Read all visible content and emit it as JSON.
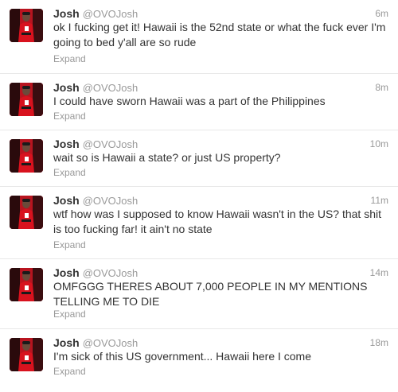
{
  "colors": {
    "avatar_bg": "#b8141f",
    "text": "#333333",
    "muted": "#999999",
    "divider": "#e8e8e8"
  },
  "tweets": [
    {
      "name": "Josh",
      "handle": "@OVOJosh",
      "time": "6m",
      "text": "ok I fucking get it! Hawaii is the 52nd state or what the fuck ever I'm going to bed y'all are so rude",
      "expand": "Expand",
      "avatar_icon": "profile-photo-icon"
    },
    {
      "name": "Josh",
      "handle": "@OVOJosh",
      "time": "8m",
      "text": "I could have sworn Hawaii was a part of the Philippines",
      "expand": "Expand",
      "avatar_icon": "profile-photo-icon"
    },
    {
      "name": "Josh",
      "handle": "@OVOJosh",
      "time": "10m",
      "text": "wait so is Hawaii a state? or just US property?",
      "expand": "Expand",
      "avatar_icon": "profile-photo-icon"
    },
    {
      "name": "Josh",
      "handle": "@OVOJosh",
      "time": "11m",
      "text": "wtf how was I supposed to know Hawaii wasn't in the US? that shit is too fucking far! it ain't no state",
      "expand": "Expand",
      "avatar_icon": "profile-photo-icon"
    },
    {
      "name": "Josh",
      "handle": "@OVOJosh",
      "time": "14m",
      "text": "OMFGGG THERES ABOUT 7,000 PEOPLE IN MY MENTIONS TELLING ME TO DIE",
      "expand": "Expand",
      "avatar_icon": "profile-photo-icon"
    },
    {
      "name": "Josh",
      "handle": "@OVOJosh",
      "time": "18m",
      "text": "I'm sick of this US government... Hawaii here I come",
      "expand": "Expand",
      "avatar_icon": "profile-photo-icon"
    }
  ]
}
